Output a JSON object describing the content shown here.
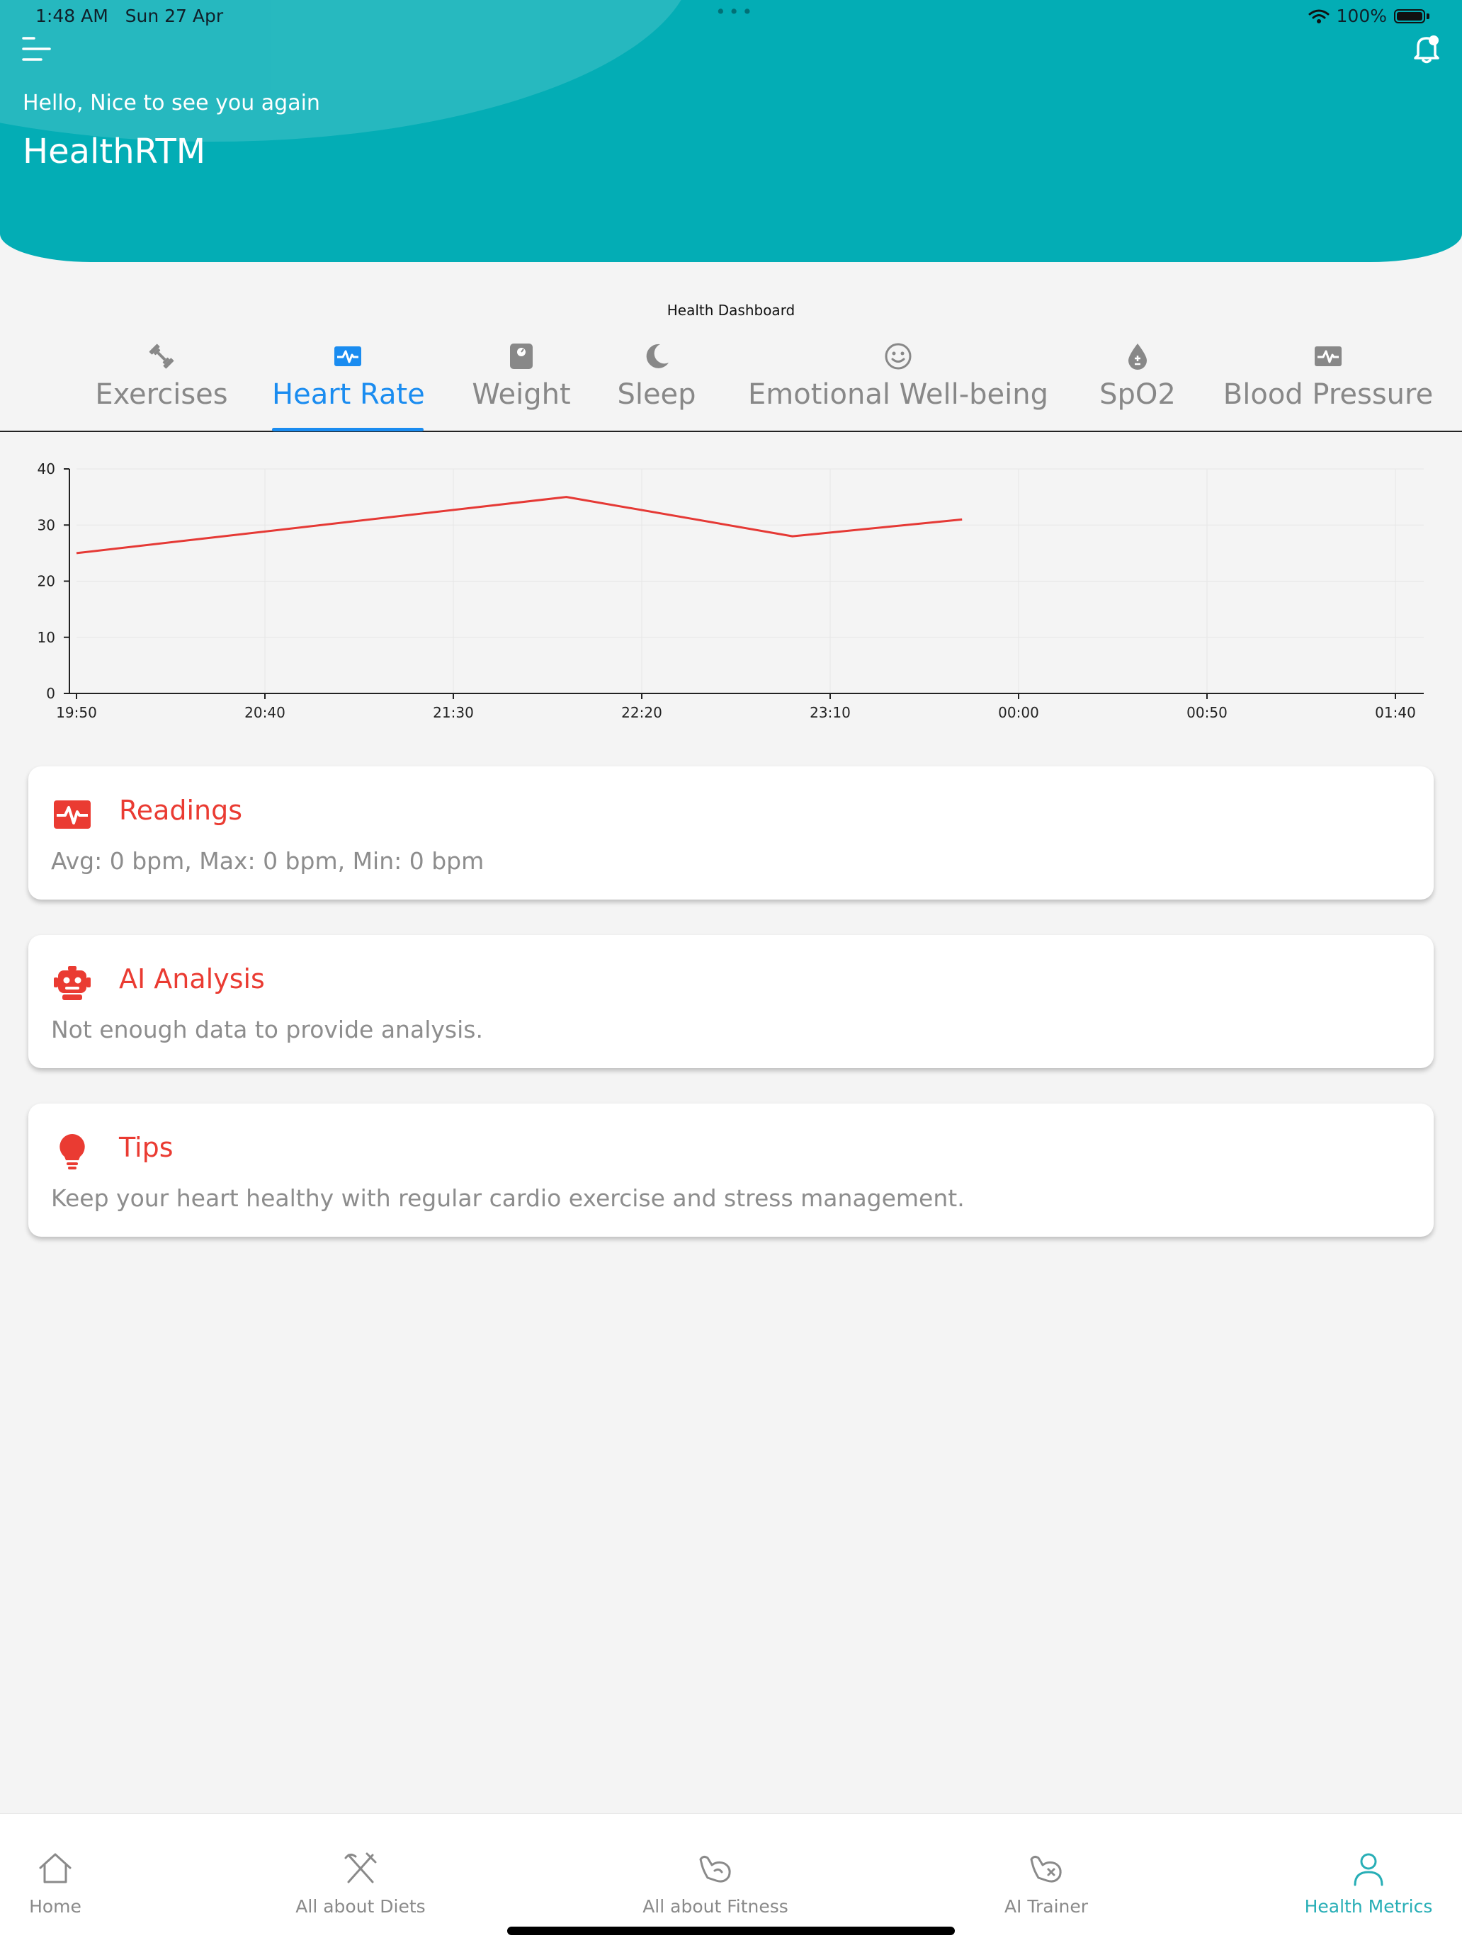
{
  "status_bar": {
    "time": "1:48 AM",
    "date": "Sun 27 Apr",
    "battery": "100%"
  },
  "header": {
    "greeting": "Hello, Nice to see you again",
    "app_title": "HealthRTM"
  },
  "dashboard_title": "Health Dashboard",
  "tabs": [
    {
      "label": "Exercises",
      "icon": "dumbbell-icon",
      "active": false
    },
    {
      "label": "Heart Rate",
      "icon": "heart-monitor-icon",
      "active": true
    },
    {
      "label": "Weight",
      "icon": "scale-icon",
      "active": false
    },
    {
      "label": "Sleep",
      "icon": "moon-icon",
      "active": false
    },
    {
      "label": "Emotional Well-being",
      "icon": "smiley-icon",
      "active": false
    },
    {
      "label": "SpO2",
      "icon": "blood-drop-icon",
      "active": false
    },
    {
      "label": "Blood Pressure",
      "icon": "monitor-pulse-icon",
      "active": false
    }
  ],
  "chart_data": {
    "type": "line",
    "x_ticks": [
      "19:50",
      "20:40",
      "21:30",
      "22:20",
      "23:10",
      "00:00",
      "00:50",
      "01:40"
    ],
    "y_ticks": [
      0,
      10,
      20,
      30,
      40
    ],
    "ylim": [
      0,
      40
    ],
    "grid": true,
    "series": [
      {
        "color": "#e53935",
        "points": [
          {
            "x": "19:50",
            "y": 25
          },
          {
            "x": "22:00",
            "y": 35
          },
          {
            "x": "23:00",
            "y": 28
          },
          {
            "x": "23:45",
            "y": 31
          }
        ]
      }
    ]
  },
  "cards": [
    {
      "title": "Readings",
      "text": "Avg: 0 bpm, Max: 0 bpm, Min: 0 bpm",
      "icon": "heart-monitor-icon"
    },
    {
      "title": "AI Analysis",
      "text": "Not enough data to provide analysis.",
      "icon": "robot-icon"
    },
    {
      "title": "Tips",
      "text": "Keep your heart healthy with regular cardio exercise and stress management.",
      "icon": "lightbulb-icon"
    }
  ],
  "bottom_nav": [
    {
      "label": "Home",
      "icon": "home-icon",
      "active": false
    },
    {
      "label": "All about Diets",
      "icon": "utensils-icon",
      "active": false
    },
    {
      "label": "All about Fitness",
      "icon": "flexed-arm-icon",
      "active": false
    },
    {
      "label": "AI Trainer",
      "icon": "trainer-arm-icon",
      "active": false
    },
    {
      "label": "Health Metrics",
      "icon": "person-icon",
      "active": true
    }
  ],
  "colors": {
    "header": "#03adb5",
    "accent": "#1a8cf0",
    "card_accent": "#ea3b32",
    "nav_active": "#27aeb6",
    "background": "#f4f4f4"
  }
}
